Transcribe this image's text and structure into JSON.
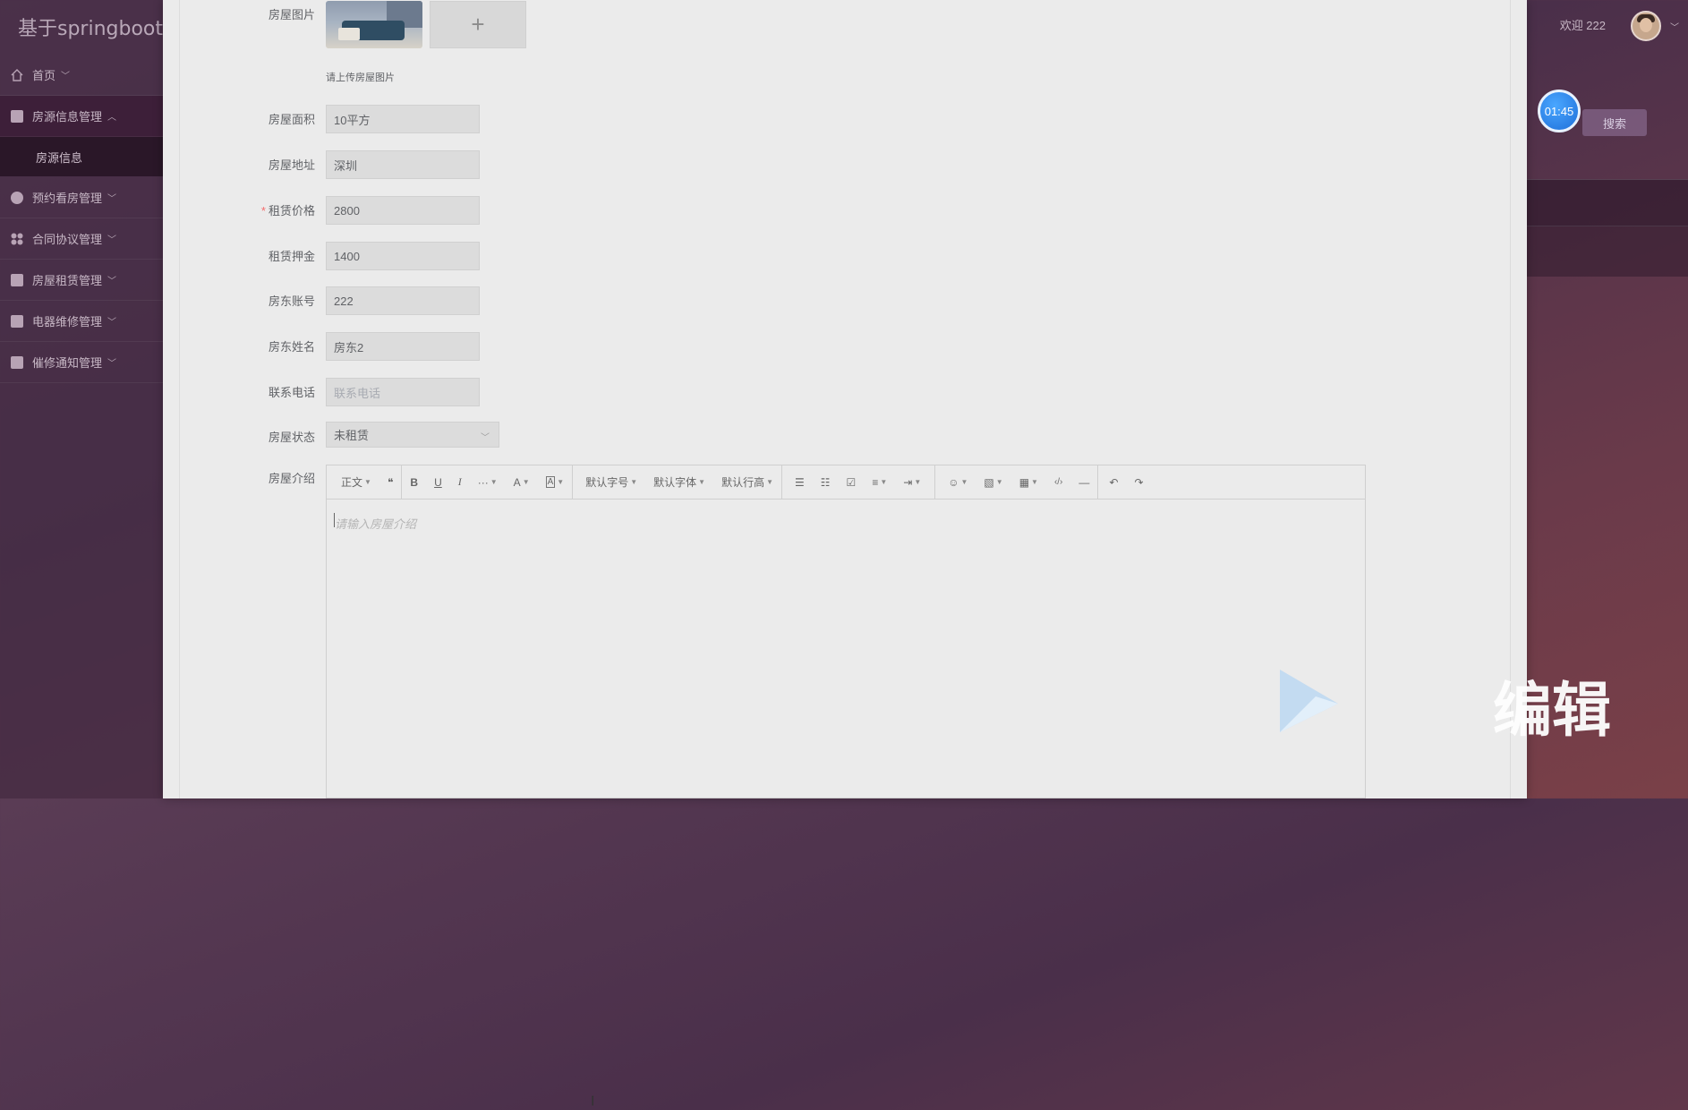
{
  "app": {
    "title": "基于springboot的"
  },
  "sidebar": {
    "items": [
      {
        "label": "首页",
        "icon": "home-icon",
        "chevron": "﹀"
      },
      {
        "label": "房源信息管理",
        "icon": "building-icon",
        "chevron": "︿"
      },
      {
        "label": "房源信息",
        "icon": "",
        "chevron": ""
      },
      {
        "label": "预约看房管理",
        "icon": "calendar-icon",
        "chevron": "﹀"
      },
      {
        "label": "合同协议管理",
        "icon": "grid-icon",
        "chevron": "﹀"
      },
      {
        "label": "房屋租赁管理",
        "icon": "wallet-icon",
        "chevron": "﹀"
      },
      {
        "label": "电器维修管理",
        "icon": "edit-icon",
        "chevron": "﹀"
      },
      {
        "label": "催修通知管理",
        "icon": "gift-icon",
        "chevron": "﹀"
      }
    ]
  },
  "header": {
    "welcome": "欢迎 222",
    "search_label": "搜索"
  },
  "timer": {
    "text": "01:45"
  },
  "watermark": {
    "text": "编辑"
  },
  "form": {
    "image_label": "房屋图片",
    "upload_plus": "+",
    "upload_tip": "请上传房屋图片",
    "area": {
      "label": "房屋面积",
      "value": "10平方"
    },
    "address": {
      "label": "房屋地址",
      "value": "深圳"
    },
    "price": {
      "label": "租赁价格",
      "required_mark": "*",
      "value": "2800"
    },
    "deposit": {
      "label": "租赁押金",
      "value": "1400"
    },
    "landlord_account": {
      "label": "房东账号",
      "value": "222"
    },
    "landlord_name": {
      "label": "房东姓名",
      "value": "房东2"
    },
    "phone": {
      "label": "联系电话",
      "placeholder": "联系电话"
    },
    "status": {
      "label": "房屋状态",
      "value": "未租赁"
    },
    "intro": {
      "label": "房屋介绍",
      "placeholder": "请输入房屋介绍"
    }
  },
  "editor_toolbar": {
    "paragraph": "正文",
    "quote": "❝",
    "bold": "B",
    "underline": "U",
    "italic": "I",
    "more": "···",
    "font_color": "A",
    "bg_color": "A",
    "font_size": "默认字号",
    "font_family": "默认字体",
    "line_height": "默认行高",
    "bullet_list": "☰",
    "numbered_list": "☷",
    "todo": "☑",
    "align": "≡",
    "indent": "⇥",
    "emotion": "☺",
    "image": "▧",
    "table": "▦",
    "code": "‹/›",
    "divider": "―",
    "undo": "↶",
    "redo": "↷"
  }
}
